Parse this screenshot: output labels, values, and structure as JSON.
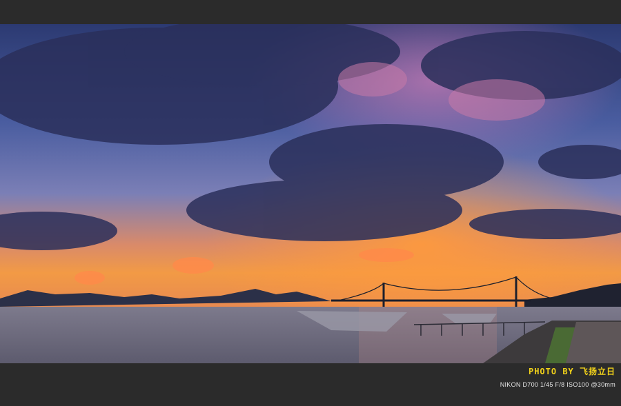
{
  "credit": {
    "label": "PHOTO BY 飞扬立日"
  },
  "exif": {
    "text": "NIKON D700  1/45 F/8 ISO100 @30mm"
  },
  "colors": {
    "frame": "#2b2b2b",
    "credit": "#f2d21a",
    "sky_top": "#3b4a86",
    "sky_horizon": "#f08a3c",
    "water": "#6f6d7e"
  }
}
